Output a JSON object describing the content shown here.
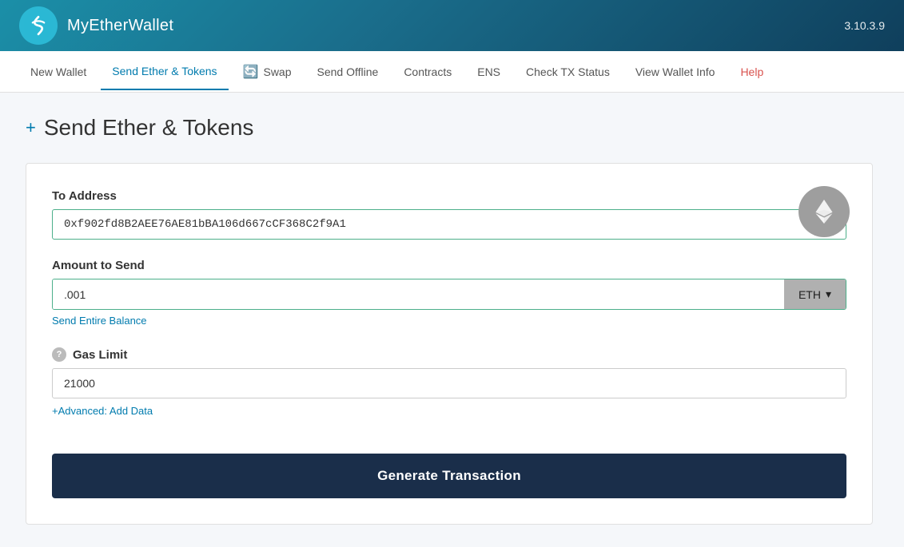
{
  "header": {
    "logo_alt": "MyEtherWallet logo",
    "title": "MyEtherWallet",
    "version": "3.10.3.9"
  },
  "nav": {
    "items": [
      {
        "id": "new-wallet",
        "label": "New Wallet",
        "active": false
      },
      {
        "id": "send-ether-tokens",
        "label": "Send Ether & Tokens",
        "active": true
      },
      {
        "id": "swap",
        "label": "Swap",
        "active": false,
        "has_icon": true
      },
      {
        "id": "send-offline",
        "label": "Send Offline",
        "active": false
      },
      {
        "id": "contracts",
        "label": "Contracts",
        "active": false
      },
      {
        "id": "ens",
        "label": "ENS",
        "active": false
      },
      {
        "id": "check-tx-status",
        "label": "Check TX Status",
        "active": false
      },
      {
        "id": "view-wallet-info",
        "label": "View Wallet Info",
        "active": false
      },
      {
        "id": "help",
        "label": "Help",
        "active": false,
        "is_help": true
      }
    ]
  },
  "page": {
    "plus_symbol": "+",
    "title": "Send Ether & Tokens"
  },
  "form": {
    "to_address_label": "To Address",
    "to_address_value": "0xf902fd8B2AEE76AE81bBA106d667cCF368C2f9A1",
    "amount_label": "Amount to Send",
    "amount_value": ".001",
    "currency_label": "ETH",
    "currency_dropdown_icon": "▾",
    "send_balance_label": "Send Entire Balance",
    "gas_limit_label": "Gas Limit",
    "gas_limit_value": "21000",
    "advanced_label": "+Advanced: Add Data",
    "generate_button_label": "Generate Transaction"
  }
}
